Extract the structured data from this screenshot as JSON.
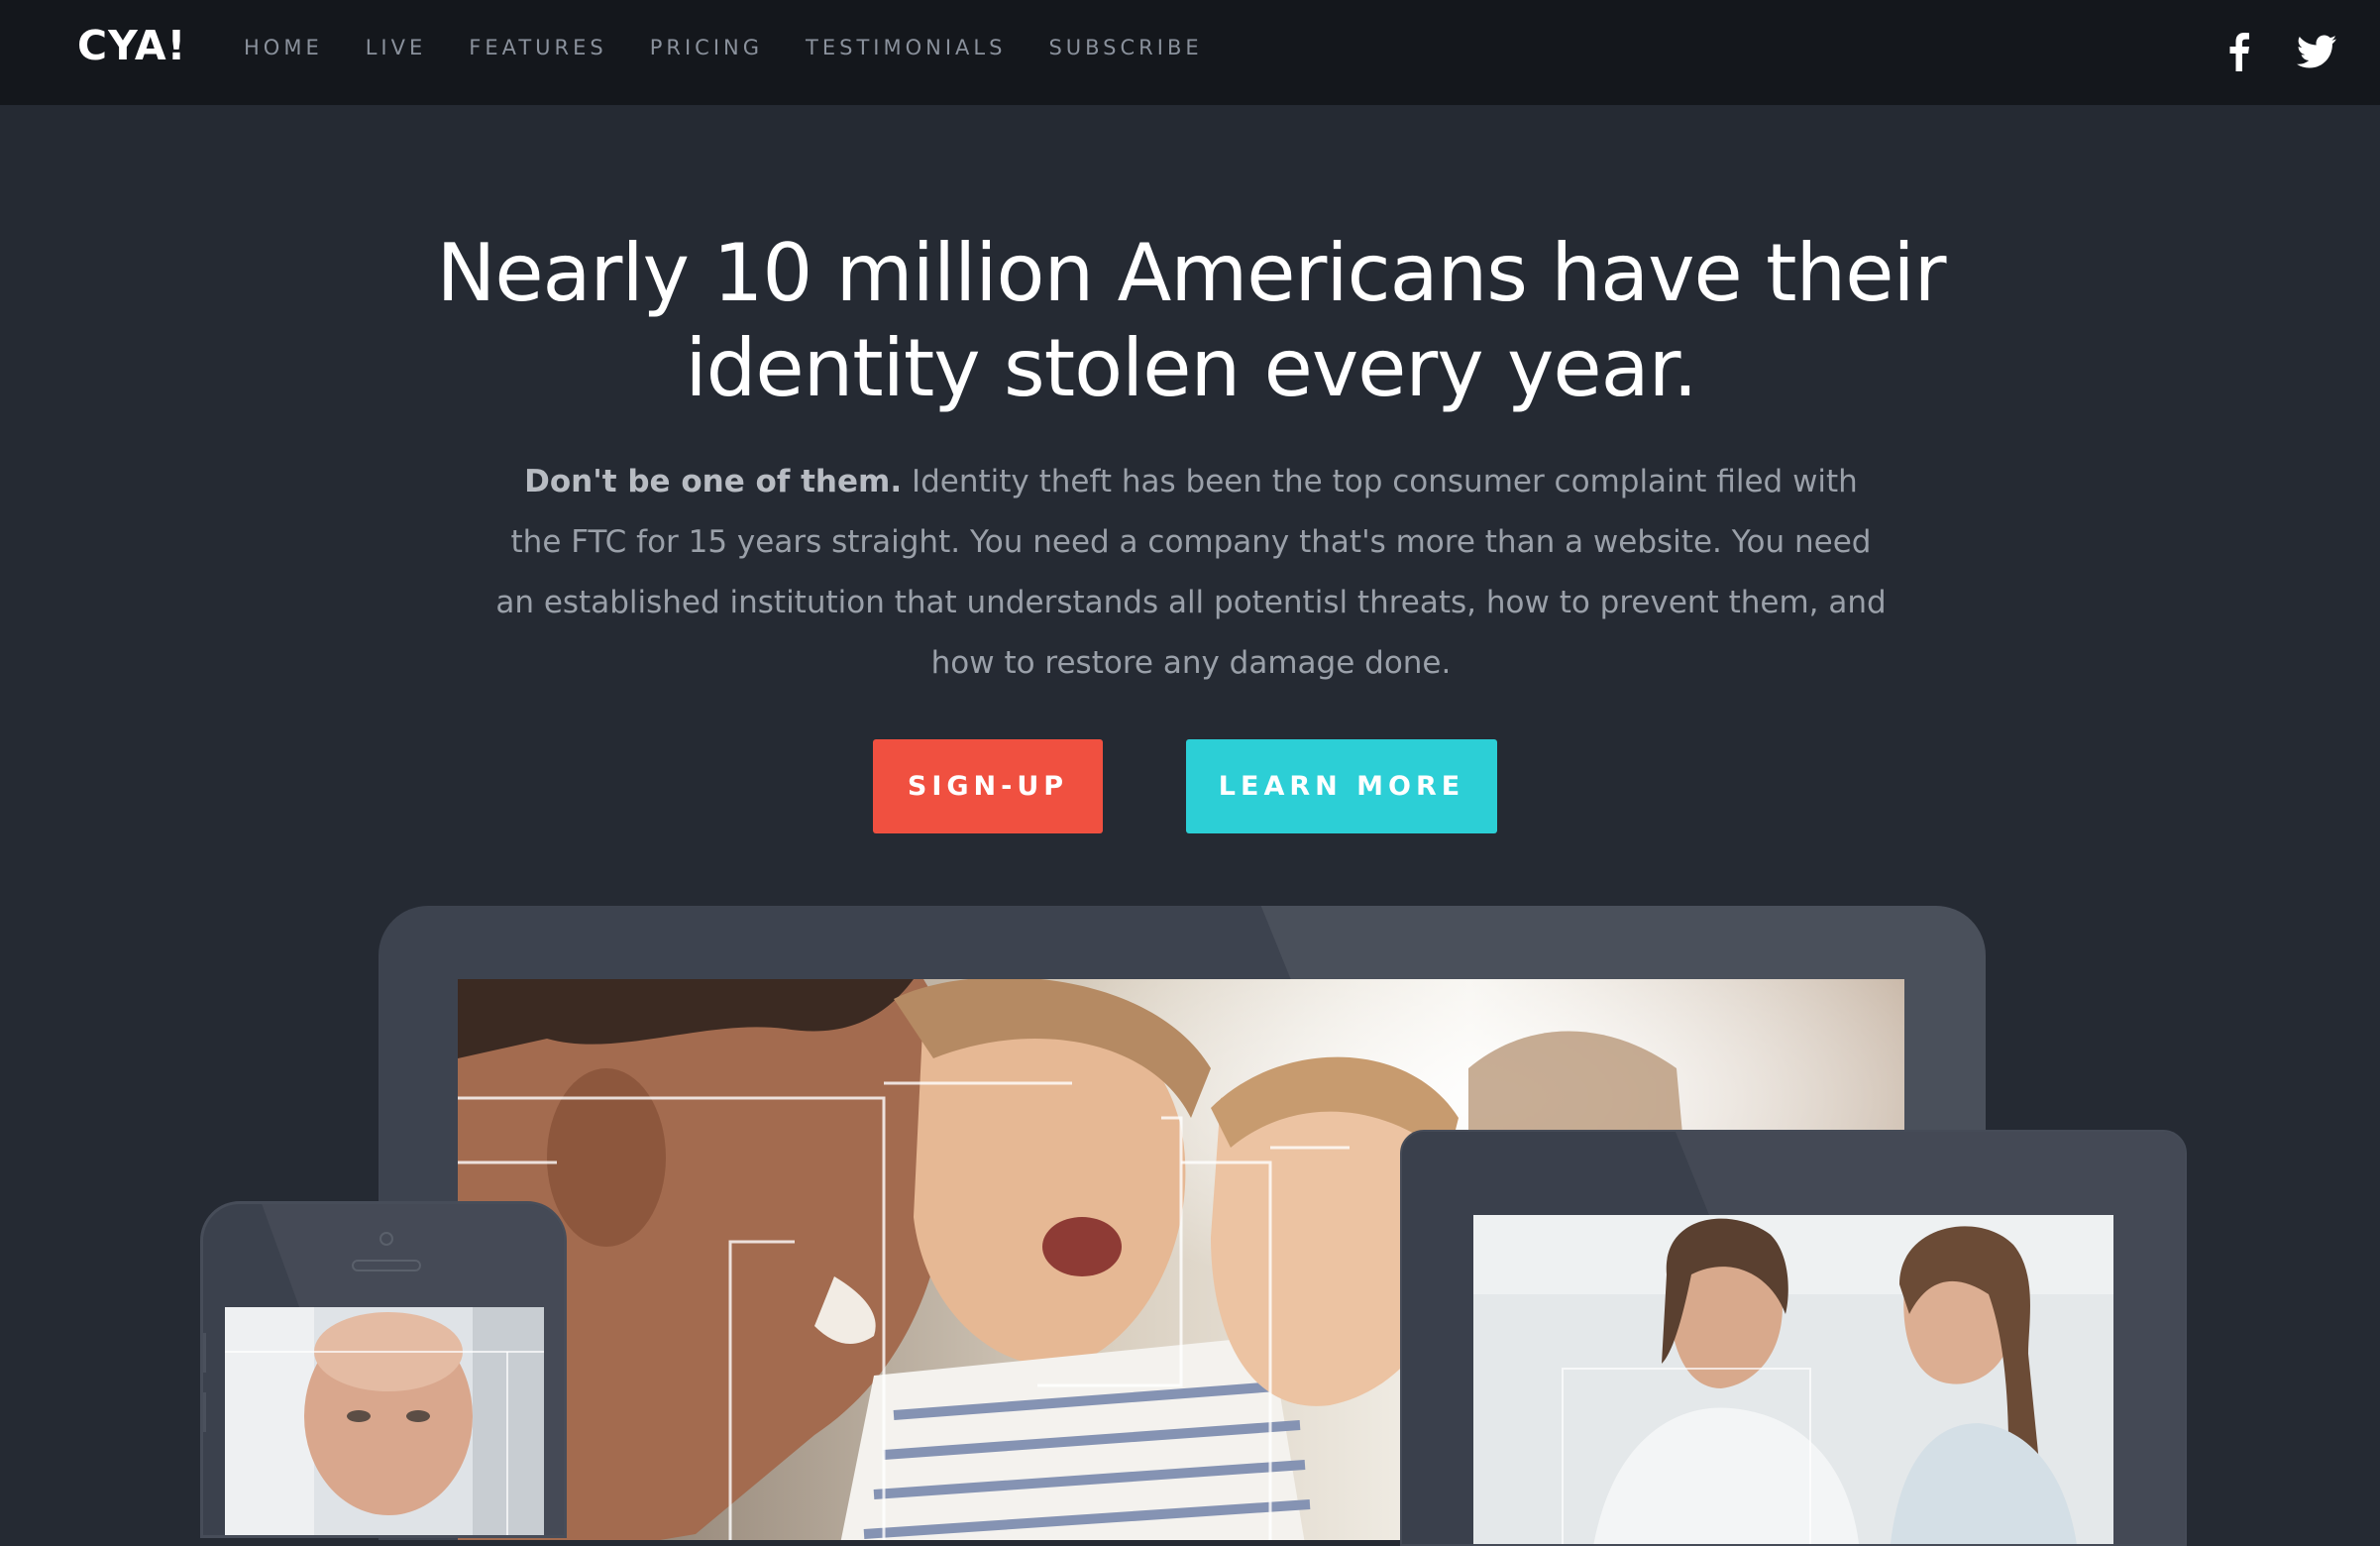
{
  "nav": {
    "logo": "CYA!",
    "items": [
      "HOME",
      "LIVE",
      "FEATURES",
      "PRICING",
      "TESTIMONIALS",
      "SUBSCRIBE"
    ],
    "social": [
      "facebook-icon",
      "twitter-icon"
    ]
  },
  "hero": {
    "title_line1": "Nearly 10 million Americans have their",
    "title_line2": "identity stolen every year.",
    "lead_bold": "Don't be one of them.",
    "lead_text": " Identity theft has been the top consumer complaint filed with the FTC for 15 years straight. You need a company that's more than a website. You need an established institution that understands all potentisl threats, how to prevent them, and how to restore any damage done.",
    "signup_label": "SIGN-UP",
    "learn_label": "LEARN MORE"
  },
  "colors": {
    "nav_bg": "#14171c",
    "page_bg": "#252a33",
    "signup": "#f05040",
    "learn_more": "#2ccfd6"
  }
}
